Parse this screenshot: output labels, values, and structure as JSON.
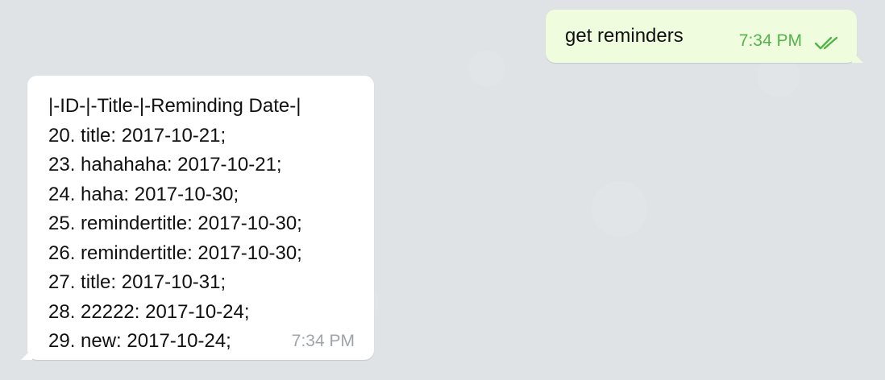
{
  "chat": {
    "background_color": "#dfe3e6",
    "outgoing_message": {
      "text": "get reminders",
      "time": "7:34 PM",
      "status_icon": "double-check-icon",
      "bubble_color": "#effdde",
      "time_color": "#54b44a"
    },
    "incoming_message": {
      "lines": [
        "|-ID-|-Title-|-Reminding Date-|",
        "20. title: 2017-10-21;",
        "23. hahahaha: 2017-10-21;",
        "24. haha: 2017-10-30;",
        "25. remindertitle: 2017-10-30;",
        "26. remindertitle: 2017-10-30;",
        "27. title: 2017-10-31;",
        "28. 22222: 2017-10-24;",
        "29. new: 2017-10-24;"
      ],
      "time": "7:34 PM",
      "bubble_color": "#ffffff",
      "time_color": "#a0a4a8"
    }
  }
}
